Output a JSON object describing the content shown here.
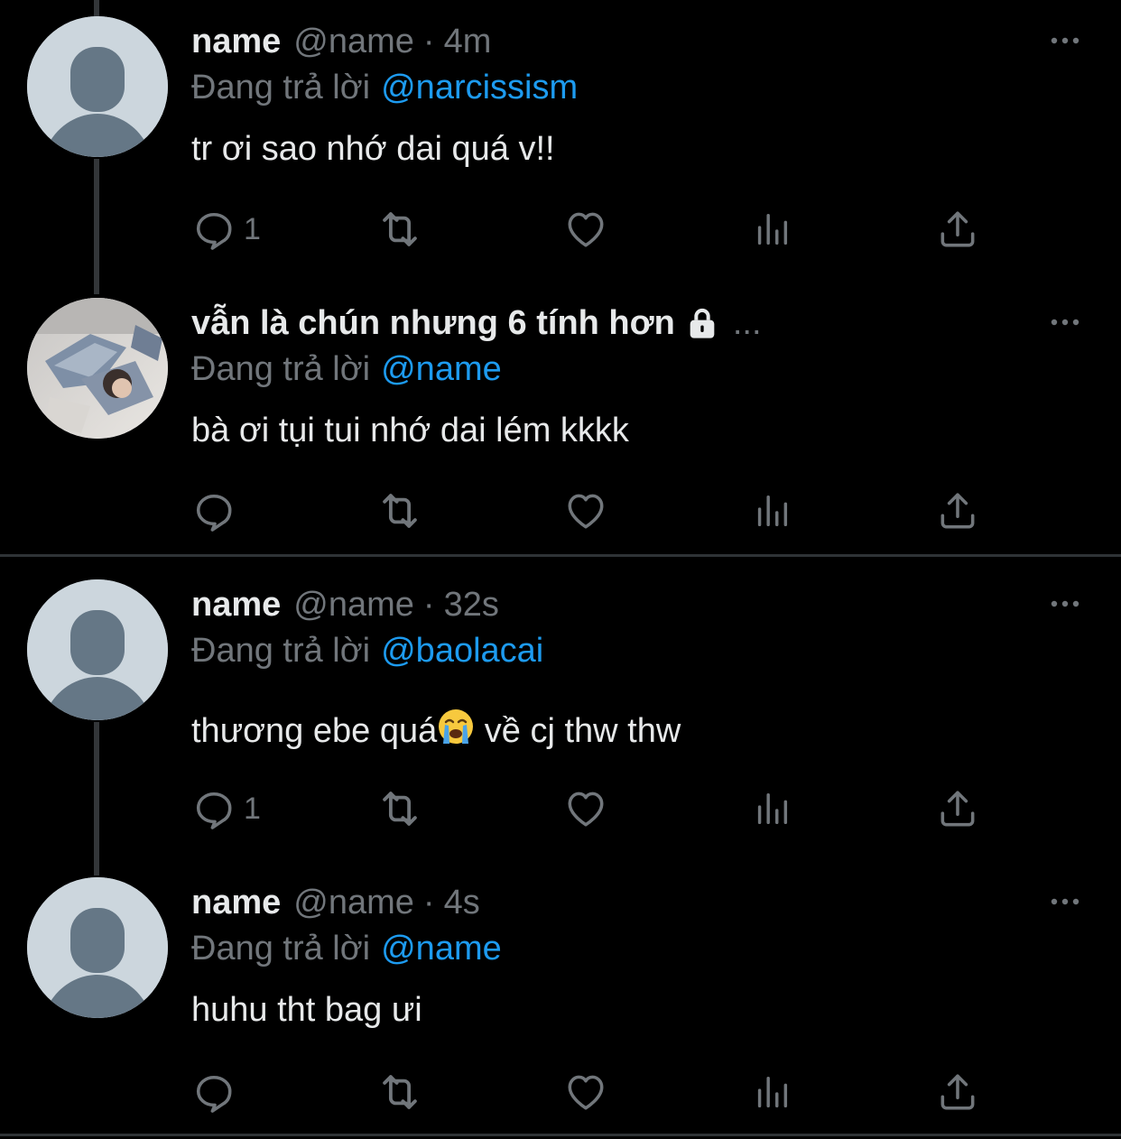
{
  "tweets": [
    {
      "name": "name",
      "handle": "@name",
      "time": "4m",
      "replying_label": "Đang trả lời",
      "replying_to": "@narcissism",
      "text": "tr ơi sao nhớ dai quá v!!",
      "reply_count": "1",
      "avatar": "default-avatar-icon"
    },
    {
      "name": "vẫn là chún nhưng 6 tính hơn",
      "handle": "",
      "time": "",
      "truncation": "...",
      "protected": true,
      "replying_label": "Đang trả lời",
      "replying_to": "@name",
      "text": "bà ơi tụi tui nhớ dai lém kkkk",
      "reply_count": "",
      "avatar": "photo-avatar"
    },
    {
      "name": "name",
      "handle": "@name",
      "time": "32s",
      "replying_label": "Đang trả lời",
      "replying_to": "@baolacai",
      "text_before": "thương ebe quá",
      "text_after": " về cj thw thw",
      "emoji": "loudly-crying-face",
      "reply_count": "1",
      "avatar": "default-avatar-icon"
    },
    {
      "name": "name",
      "handle": "@name",
      "time": "4s",
      "replying_label": "Đang trả lời",
      "replying_to": "@name",
      "text": "huhu tht bag ưi",
      "reply_count": "",
      "avatar": "default-avatar-icon"
    }
  ],
  "separator": "·",
  "colors": {
    "background": "#000000",
    "text": "#e7e9ea",
    "muted": "#71767b",
    "mention": "#1d9bf0",
    "thread_line": "#333639",
    "divider": "#2f3336"
  },
  "icons": [
    "reply-icon",
    "retweet-icon",
    "like-icon",
    "analytics-icon",
    "share-icon",
    "more-options-icon",
    "lock-icon"
  ]
}
